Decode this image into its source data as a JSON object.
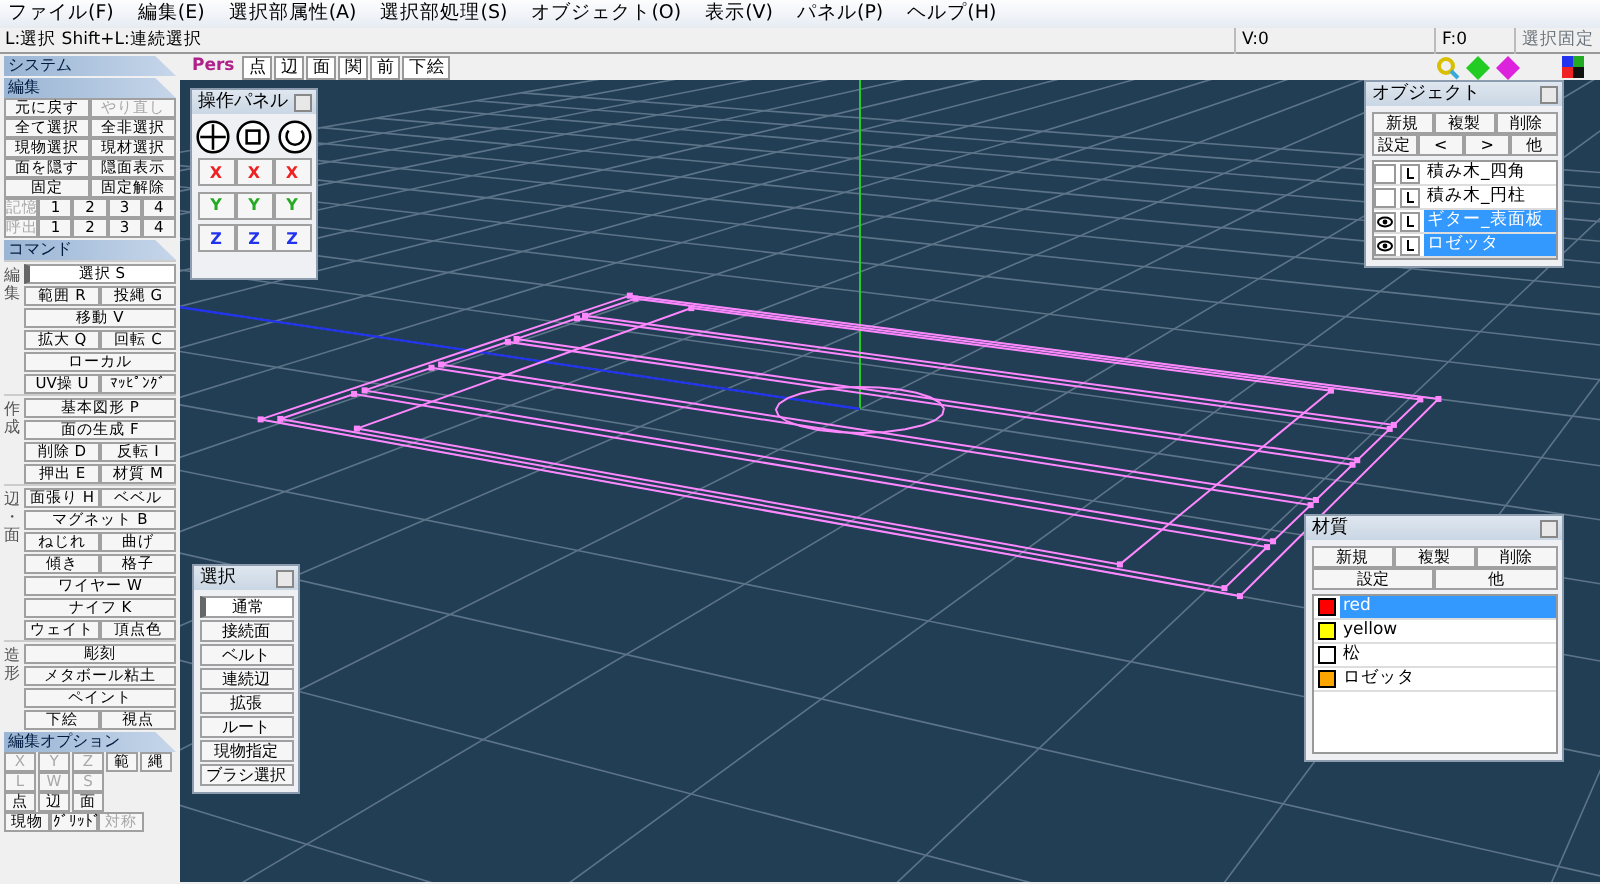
{
  "menu": [
    "ファイル(F)",
    "編集(E)",
    "選択部属性(A)",
    "選択部処理(S)",
    "オブジェクト(O)",
    "表示(V)",
    "パネル(P)",
    "ヘルプ(H)"
  ],
  "status_bar": {
    "hint": "L:選択 Shift+L:連続選択",
    "vertices": "V:0",
    "faces": "F:0",
    "lock_button": {
      "label": "選択固定",
      "disabled": true
    }
  },
  "sidebar": {
    "system_header": "システム",
    "edit": {
      "header": "編集",
      "rows": [
        [
          {
            "label": "元に戻す",
            "disabled": false
          },
          {
            "label": "やり直し",
            "disabled": true
          }
        ],
        [
          {
            "label": "全て選択",
            "disabled": false
          },
          {
            "label": "全非選択",
            "disabled": false
          }
        ],
        [
          {
            "label": "現物選択",
            "disabled": false
          },
          {
            "label": "現材選択",
            "disabled": false
          }
        ],
        [
          {
            "label": "面を隠す",
            "disabled": false
          },
          {
            "label": "隠面表示",
            "disabled": false
          }
        ],
        [
          {
            "label": "固定",
            "disabled": false
          },
          {
            "label": "固定解除",
            "disabled": false
          }
        ]
      ],
      "memory": [
        {
          "label": "記憶",
          "slots": [
            "1",
            "2",
            "3",
            "4"
          ]
        },
        {
          "label": "呼出",
          "slots": [
            "1",
            "2",
            "3",
            "4"
          ]
        }
      ]
    },
    "command": {
      "header": "コマンド",
      "groups": [
        {
          "label": "編集",
          "rows": [
            [
              {
                "label": "選択 S",
                "selected": true
              }
            ],
            [
              {
                "label": "範囲 R",
                "selected": false
              },
              {
                "label": "投縄 G",
                "selected": false
              }
            ],
            [
              {
                "label": "移動 V",
                "selected": false
              }
            ],
            [
              {
                "label": "拡大 Q",
                "selected": false
              },
              {
                "label": "回転 C",
                "selected": false
              }
            ],
            [
              {
                "label": "ローカル",
                "selected": false
              }
            ],
            [
              {
                "label": "UV操 U",
                "selected": false
              },
              {
                "label": "ﾏｯﾋﾟﾝｸﾞ",
                "selected": false
              }
            ]
          ]
        },
        {
          "label": "作成",
          "rows": [
            [
              {
                "label": "基本図形 P",
                "selected": false
              }
            ],
            [
              {
                "label": "面の生成 F",
                "selected": false
              }
            ],
            [
              {
                "label": "削除 D",
                "selected": false
              },
              {
                "label": "反転 I",
                "selected": false
              }
            ],
            [
              {
                "label": "押出 E",
                "selected": false
              },
              {
                "label": "材質 M",
                "selected": false
              }
            ]
          ]
        },
        {
          "label": "辺・面",
          "rows": [
            [
              {
                "label": "面張り H",
                "selected": false
              },
              {
                "label": "ベベル",
                "selected": false
              }
            ],
            [
              {
                "label": "マグネット B",
                "selected": false
              }
            ],
            [
              {
                "label": "ねじれ",
                "selected": false
              },
              {
                "label": "曲げ",
                "selected": false
              }
            ],
            [
              {
                "label": "傾き",
                "selected": false
              },
              {
                "label": "格子",
                "selected": false
              }
            ],
            [
              {
                "label": "ワイヤー W",
                "selected": false
              }
            ],
            [
              {
                "label": "ナイフ K",
                "selected": false
              }
            ],
            [
              {
                "label": "ウェイト",
                "selected": false
              },
              {
                "label": "頂点色",
                "selected": false
              }
            ]
          ]
        },
        {
          "label": "造形",
          "rows": [
            [
              {
                "label": "彫刻",
                "selected": false
              }
            ],
            [
              {
                "label": "メタボール粘土",
                "selected": false
              }
            ],
            [
              {
                "label": "ペイント",
                "selected": false
              }
            ],
            [
              {
                "label": "下絵",
                "selected": false
              },
              {
                "label": "視点",
                "selected": false
              }
            ]
          ]
        }
      ]
    },
    "options": {
      "header": "編集オプション",
      "rows": [
        [
          {
            "label": "X",
            "disabled": true
          },
          {
            "label": "Y",
            "disabled": true
          },
          {
            "label": "Z",
            "disabled": true
          },
          {
            "label": "範",
            "disabled": false
          },
          {
            "label": "縄",
            "disabled": false
          }
        ],
        [
          {
            "label": "L",
            "disabled": true
          },
          {
            "label": "W",
            "disabled": true
          },
          {
            "label": "S",
            "disabled": true
          }
        ],
        [
          {
            "label": "点",
            "disabled": false
          },
          {
            "label": "辺",
            "disabled": false
          },
          {
            "label": "面",
            "disabled": false
          }
        ]
      ],
      "snap_buttons": [
        {
          "label": "現物",
          "disabled": false
        },
        {
          "label": "ｸﾞﾘｯﾄﾞ",
          "disabled": false
        },
        {
          "label": "対称",
          "disabled": true
        }
      ]
    }
  },
  "viewport_toolbar": {
    "projection": "Pers",
    "buttons": [
      "点",
      "辺",
      "面",
      "関",
      "前",
      "下絵"
    ]
  },
  "operation_panel": {
    "title": "操作パネル",
    "rows": [
      [
        "X",
        "X",
        "X"
      ],
      [
        "Y",
        "Y",
        "Y"
      ],
      [
        "Z",
        "Z",
        "Z"
      ]
    ]
  },
  "object_panel": {
    "title": "オブジェクト",
    "buttons": [
      [
        "新規",
        "複製",
        "削除"
      ],
      [
        "設定",
        "<",
        ">",
        "他"
      ]
    ],
    "objects": [
      {
        "name": "積み木_四角",
        "visible": false,
        "selected": false
      },
      {
        "name": "積み木_円柱",
        "visible": false,
        "selected": false
      },
      {
        "name": "ギター_表面板",
        "visible": true,
        "selected": true
      },
      {
        "name": "ロゼッタ",
        "visible": true,
        "selected": true
      }
    ]
  },
  "selection_panel": {
    "title": "選択",
    "items": [
      {
        "label": "通常",
        "selected": true
      },
      {
        "label": "接続面",
        "selected": false
      },
      {
        "label": "ベルト",
        "selected": false
      },
      {
        "label": "連続辺",
        "selected": false
      },
      {
        "label": "拡張",
        "selected": false
      },
      {
        "label": "ルート",
        "selected": false
      },
      {
        "label": "現物指定",
        "selected": false
      },
      {
        "label": "ブラシ選択",
        "selected": false
      }
    ]
  },
  "material_panel": {
    "title": "材質",
    "buttons": [
      [
        "新規",
        "複製",
        "削除"
      ],
      [
        "設定",
        "他"
      ]
    ],
    "materials": [
      {
        "name": "red",
        "color": "#ff0000",
        "selected": true
      },
      {
        "name": "yellow",
        "color": "#ffff00",
        "selected": false
      },
      {
        "name": "松",
        "color": "#ffffff",
        "selected": false
      },
      {
        "name": "ロゼッタ",
        "color": "#ffa500",
        "selected": false
      }
    ]
  }
}
